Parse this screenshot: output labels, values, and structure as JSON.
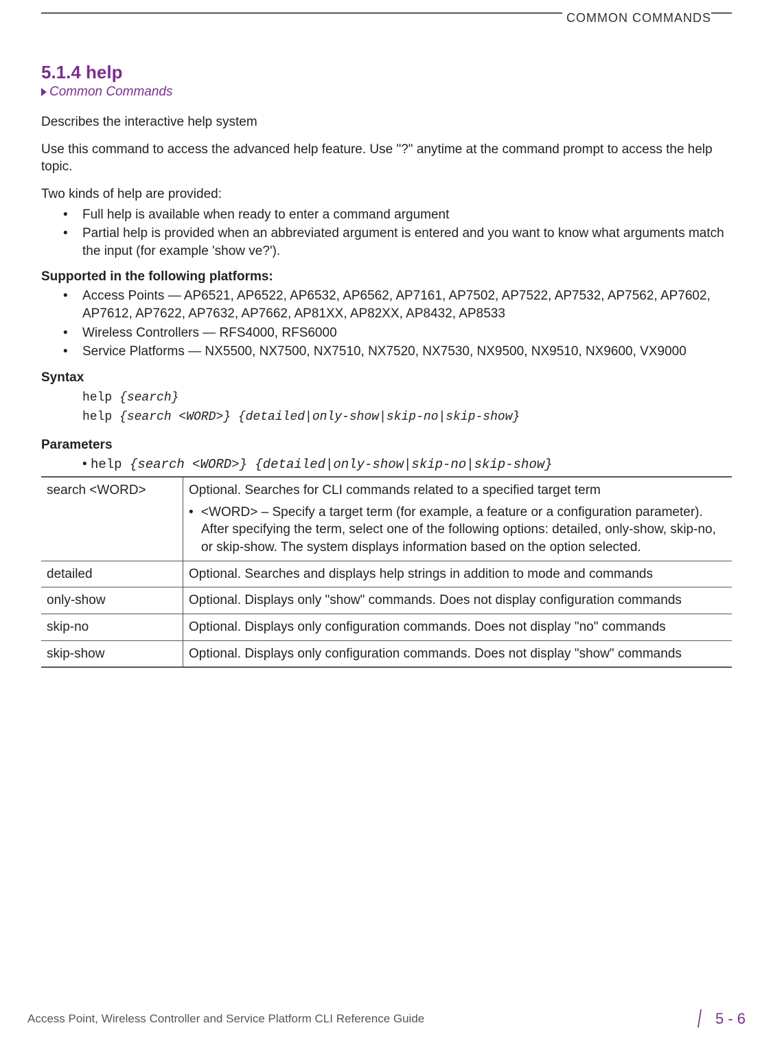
{
  "header": {
    "running_head": "COMMON COMMANDS"
  },
  "section": {
    "number_title": "5.1.4 help",
    "breadcrumb": "Common Commands"
  },
  "paragraphs": {
    "p1": "Describes the interactive help system",
    "p2": "Use this command to access the advanced help feature. Use \"?\" anytime at the command prompt to access the help topic.",
    "p3": "Two kinds of help are provided:"
  },
  "help_kinds": [
    "Full help is available when ready to enter a command argument",
    "Partial help is provided when an abbreviated argument is entered and you want to know what arguments match the input (for example 'show ve?')."
  ],
  "platforms_heading": "Supported in the following platforms:",
  "platforms": [
    "Access Points — AP6521, AP6522, AP6532, AP6562, AP7161, AP7502, AP7522, AP7532, AP7562, AP7602, AP7612, AP7622, AP7632, AP7662, AP81XX, AP82XX, AP8432, AP8533",
    "Wireless Controllers — RFS4000, RFS6000",
    "Service Platforms — NX5500, NX7500, NX7510, NX7520, NX7530, NX9500, NX9510, NX9600, VX9000"
  ],
  "syntax_heading": "Syntax",
  "syntax": {
    "line1_cmd": "help ",
    "line1_arg": "{search}",
    "line2_cmd": "help ",
    "line2_arg": "{search <WORD>} {detailed|only-show|skip-no|skip-show}"
  },
  "parameters_heading": "Parameters",
  "param_intro_prefix": "• ",
  "param_intro_cmd": "help ",
  "param_intro_arg": "{search <WORD>} {detailed|only-show|skip-no|skip-show}",
  "param_table": [
    {
      "name": "search <WORD>",
      "desc_main": "Optional. Searches for CLI commands related to a specified target term",
      "desc_sub": "<WORD> – Specify a target term (for example, a feature or a configuration parameter). After specifying the term, select one of the following options: detailed, only-show, skip-no, or skip-show. The system displays information based on the option selected."
    },
    {
      "name": "detailed",
      "desc_main": "Optional. Searches and displays help strings in addition to mode and commands"
    },
    {
      "name": "only-show",
      "desc_main": "Optional. Displays only \"show\" commands. Does not display configuration commands"
    },
    {
      "name": "skip-no",
      "desc_main": "Optional. Displays only configuration commands. Does not display \"no\" commands"
    },
    {
      "name": "skip-show",
      "desc_main": "Optional. Displays only configuration commands. Does not display \"show\" commands"
    }
  ],
  "footer": {
    "doc_title": "Access Point, Wireless Controller and Service Platform CLI Reference Guide",
    "page_num": "5 - 6"
  }
}
